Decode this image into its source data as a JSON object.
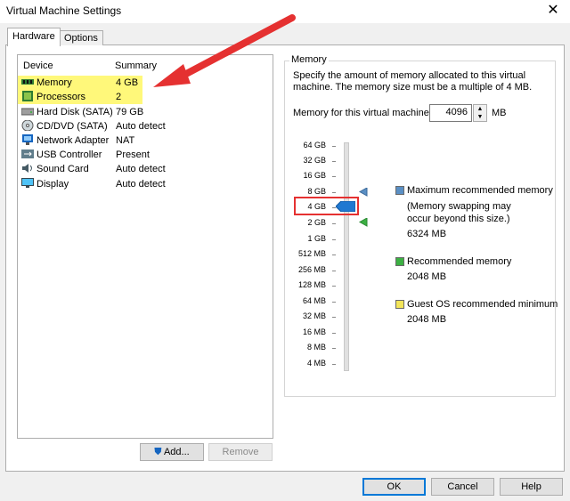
{
  "window": {
    "title": "Virtual Machine Settings",
    "close_glyph": "✕"
  },
  "tabs": [
    {
      "label": "Hardware"
    },
    {
      "label": "Options"
    }
  ],
  "device_list": {
    "columns": [
      "Device",
      "Summary"
    ],
    "rows": [
      {
        "device": "Memory",
        "summary": "4 GB",
        "icon": "memory-icon"
      },
      {
        "device": "Processors",
        "summary": "2",
        "icon": "processor-icon"
      },
      {
        "device": "Hard Disk (SATA)",
        "summary": "79 GB",
        "icon": "hard-disk-icon"
      },
      {
        "device": "CD/DVD (SATA)",
        "summary": "Auto detect",
        "icon": "cd-dvd-icon"
      },
      {
        "device": "Network Adapter",
        "summary": "NAT",
        "icon": "network-icon"
      },
      {
        "device": "USB Controller",
        "summary": "Present",
        "icon": "usb-icon"
      },
      {
        "device": "Sound Card",
        "summary": "Auto detect",
        "icon": "sound-icon"
      },
      {
        "device": "Display",
        "summary": "Auto detect",
        "icon": "display-icon"
      }
    ]
  },
  "memory": {
    "group_label": "Memory",
    "description": "Specify the amount of memory allocated to this virtual machine. The memory size must be a multiple of 4 MB.",
    "field_label": "Memory for this virtual machine:",
    "value": "4096",
    "unit": "MB",
    "scale_ticks": [
      "64 GB",
      "32 GB",
      "16 GB",
      "8 GB",
      "4 GB",
      "2 GB",
      "1 GB",
      "512 MB",
      "256 MB",
      "128 MB",
      "64 MB",
      "32 MB",
      "16 MB",
      "8 MB",
      "4 MB"
    ],
    "legend": [
      {
        "label": "Maximum recommended memory",
        "note": "(Memory swapping may occur beyond this size.)",
        "value": "6324 MB",
        "color": "#5a8fc4"
      },
      {
        "label": "Recommended memory",
        "value": "2048 MB",
        "color": "#3cb043"
      },
      {
        "label": "Guest OS recommended minimum",
        "value": "2048 MB",
        "color": "#f3e55a"
      }
    ],
    "slider_color": "#1f78d1"
  },
  "buttons": {
    "add": "Add...",
    "remove": "Remove",
    "ok": "OK",
    "cancel": "Cancel",
    "help": "Help"
  },
  "colors": {
    "highlight": "#fff87a",
    "annotation_red": "#e53131"
  }
}
